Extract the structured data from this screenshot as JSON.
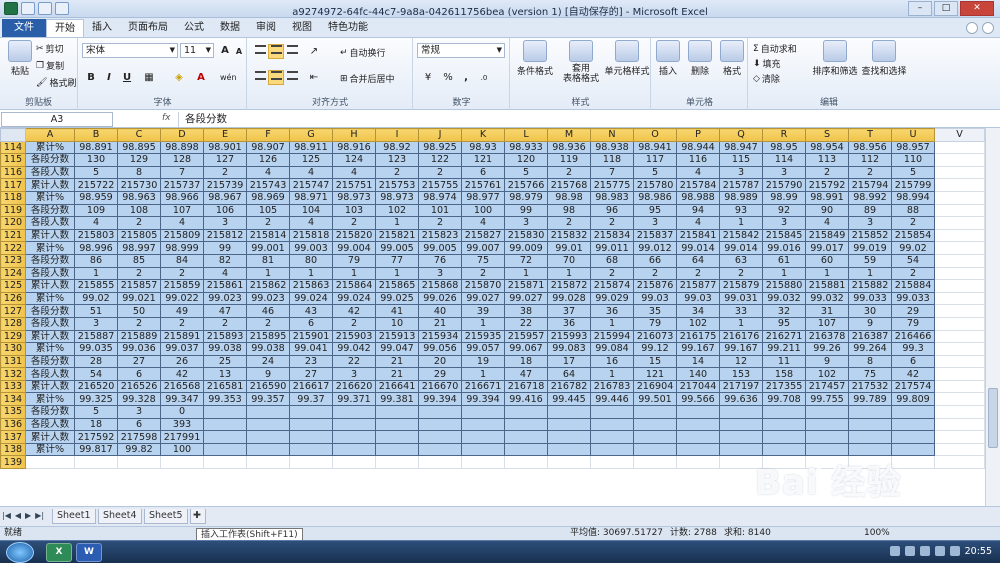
{
  "window": {
    "title": "a9274972-64fc-44c7-9a8a-042611756bea (version 1) [自动保存的] - Microsoft Excel",
    "min": "–",
    "max": "□",
    "close": "✕"
  },
  "tabs": [
    "文件",
    "开始",
    "插入",
    "页面布局",
    "公式",
    "数据",
    "审阅",
    "视图",
    "特色功能"
  ],
  "ribbon": {
    "clipboard": {
      "label": "剪贴板",
      "paste": "粘贴",
      "cut": "剪切",
      "copy": "复制",
      "format_painter": "格式刷"
    },
    "font": {
      "label": "字体",
      "name": "宋体",
      "size": "11",
      "bold": "B",
      "italic": "I",
      "underline": "U",
      "grow": "A",
      "shrink": "A",
      "wen": "wén"
    },
    "alignment": {
      "label": "对齐方式",
      "wrap": "自动换行",
      "merge": "合并后居中"
    },
    "number": {
      "label": "数字",
      "format": "常规",
      "percent": "%",
      "comma": ","
    },
    "styles": {
      "label": "样式",
      "conditional": "条件格式",
      "table": "套用\n表格格式",
      "cell": "单元格样式"
    },
    "cells": {
      "label": "单元格",
      "insert": "插入",
      "delete": "删除",
      "format": "格式"
    },
    "editing": {
      "label": "编辑",
      "autosum": "自动求和",
      "fill": "填充",
      "clear": "清除",
      "sort": "排序和筛选",
      "find": "查找和选择"
    }
  },
  "formula": {
    "cell": "A3",
    "fx": "fx",
    "value": "各段分数"
  },
  "columns": [
    "A",
    "B",
    "C",
    "D",
    "E",
    "F",
    "G",
    "H",
    "I",
    "J",
    "K",
    "L",
    "M",
    "N",
    "O",
    "P",
    "Q",
    "R",
    "S",
    "T",
    "U",
    "V"
  ],
  "rows": [
    {
      "n": "114",
      "cells": [
        "累计%",
        "98.891",
        "98.895",
        "98.898",
        "98.901",
        "98.907",
        "98.911",
        "98.916",
        "98.92",
        "98.925",
        "98.93",
        "98.933",
        "98.936",
        "98.938",
        "98.941",
        "98.944",
        "98.947",
        "98.95",
        "98.954",
        "98.956",
        "98.957"
      ]
    },
    {
      "n": "115",
      "cells": [
        "各段分数",
        "130",
        "129",
        "128",
        "127",
        "126",
        "125",
        "124",
        "123",
        "122",
        "121",
        "120",
        "119",
        "118",
        "117",
        "116",
        "115",
        "114",
        "113",
        "112",
        "110"
      ]
    },
    {
      "n": "116",
      "cells": [
        "各段人数",
        "5",
        "8",
        "7",
        "2",
        "4",
        "4",
        "4",
        "2",
        "2",
        "6",
        "5",
        "2",
        "7",
        "5",
        "4",
        "3",
        "3",
        "2",
        "2",
        "5"
      ]
    },
    {
      "n": "117",
      "cells": [
        "累计人数",
        "215722",
        "215730",
        "215737",
        "215739",
        "215743",
        "215747",
        "215751",
        "215753",
        "215755",
        "215761",
        "215766",
        "215768",
        "215775",
        "215780",
        "215784",
        "215787",
        "215790",
        "215792",
        "215794",
        "215799"
      ]
    },
    {
      "n": "118",
      "cells": [
        "累计%",
        "98.959",
        "98.963",
        "98.966",
        "98.967",
        "98.969",
        "98.971",
        "98.973",
        "98.973",
        "98.974",
        "98.977",
        "98.979",
        "98.98",
        "98.983",
        "98.986",
        "98.988",
        "98.989",
        "98.99",
        "98.991",
        "98.992",
        "98.994"
      ]
    },
    {
      "n": "119",
      "cells": [
        "各段分数",
        "109",
        "108",
        "107",
        "106",
        "105",
        "104",
        "103",
        "102",
        "101",
        "100",
        "99",
        "98",
        "96",
        "95",
        "94",
        "93",
        "92",
        "90",
        "89",
        "88"
      ]
    },
    {
      "n": "120",
      "cells": [
        "各段人数",
        "4",
        "2",
        "4",
        "3",
        "2",
        "4",
        "2",
        "1",
        "2",
        "4",
        "3",
        "2",
        "2",
        "3",
        "4",
        "1",
        "3",
        "4",
        "3",
        "2"
      ]
    },
    {
      "n": "121",
      "cells": [
        "累计人数",
        "215803",
        "215805",
        "215809",
        "215812",
        "215814",
        "215818",
        "215820",
        "215821",
        "215823",
        "215827",
        "215830",
        "215832",
        "215834",
        "215837",
        "215841",
        "215842",
        "215845",
        "215849",
        "215852",
        "215854"
      ]
    },
    {
      "n": "122",
      "cells": [
        "累计%",
        "98.996",
        "98.997",
        "98.999",
        "99",
        "99.001",
        "99.003",
        "99.004",
        "99.005",
        "99.005",
        "99.007",
        "99.009",
        "99.01",
        "99.011",
        "99.012",
        "99.014",
        "99.014",
        "99.016",
        "99.017",
        "99.019",
        "99.02"
      ]
    },
    {
      "n": "123",
      "cells": [
        "各段分数",
        "86",
        "85",
        "84",
        "82",
        "81",
        "80",
        "79",
        "77",
        "76",
        "75",
        "72",
        "70",
        "68",
        "66",
        "64",
        "63",
        "61",
        "60",
        "59",
        "54"
      ]
    },
    {
      "n": "124",
      "cells": [
        "各段人数",
        "1",
        "2",
        "2",
        "4",
        "1",
        "1",
        "1",
        "1",
        "3",
        "2",
        "1",
        "1",
        "2",
        "2",
        "2",
        "2",
        "1",
        "1",
        "1",
        "2"
      ]
    },
    {
      "n": "125",
      "cells": [
        "累计人数",
        "215855",
        "215857",
        "215859",
        "215861",
        "215862",
        "215863",
        "215864",
        "215865",
        "215868",
        "215870",
        "215871",
        "215872",
        "215874",
        "215876",
        "215877",
        "215879",
        "215880",
        "215881",
        "215882",
        "215884"
      ]
    },
    {
      "n": "126",
      "cells": [
        "累计%",
        "99.02",
        "99.021",
        "99.022",
        "99.023",
        "99.023",
        "99.024",
        "99.024",
        "99.025",
        "99.026",
        "99.027",
        "99.027",
        "99.028",
        "99.029",
        "99.03",
        "99.03",
        "99.031",
        "99.032",
        "99.032",
        "99.033",
        "99.033"
      ]
    },
    {
      "n": "127",
      "cells": [
        "各段分数",
        "51",
        "50",
        "49",
        "47",
        "46",
        "43",
        "42",
        "41",
        "40",
        "39",
        "38",
        "37",
        "36",
        "35",
        "34",
        "33",
        "32",
        "31",
        "30",
        "29"
      ]
    },
    {
      "n": "128",
      "cells": [
        "各段人数",
        "3",
        "2",
        "2",
        "2",
        "2",
        "6",
        "2",
        "10",
        "21",
        "1",
        "22",
        "36",
        "1",
        "79",
        "102",
        "1",
        "95",
        "107",
        "9",
        "79"
      ]
    },
    {
      "n": "129",
      "cells": [
        "累计人数",
        "215887",
        "215889",
        "215891",
        "215893",
        "215895",
        "215901",
        "215903",
        "215913",
        "215934",
        "215935",
        "215957",
        "215993",
        "215994",
        "216073",
        "216175",
        "216176",
        "216271",
        "216378",
        "216387",
        "216466"
      ]
    },
    {
      "n": "130",
      "cells": [
        "累计%",
        "99.035",
        "99.036",
        "99.037",
        "99.038",
        "99.038",
        "99.041",
        "99.042",
        "99.047",
        "99.056",
        "99.057",
        "99.067",
        "99.083",
        "99.084",
        "99.12",
        "99.167",
        "99.167",
        "99.211",
        "99.26",
        "99.264",
        "99.3"
      ]
    },
    {
      "n": "131",
      "cells": [
        "各段分数",
        "28",
        "27",
        "26",
        "25",
        "24",
        "23",
        "22",
        "21",
        "20",
        "19",
        "18",
        "17",
        "16",
        "15",
        "14",
        "12",
        "11",
        "9",
        "8",
        "6"
      ]
    },
    {
      "n": "132",
      "cells": [
        "各段人数",
        "54",
        "6",
        "42",
        "13",
        "9",
        "27",
        "3",
        "21",
        "29",
        "1",
        "47",
        "64",
        "1",
        "121",
        "140",
        "153",
        "158",
        "102",
        "75",
        "42"
      ]
    },
    {
      "n": "133",
      "cells": [
        "累计人数",
        "216520",
        "216526",
        "216568",
        "216581",
        "216590",
        "216617",
        "216620",
        "216641",
        "216670",
        "216671",
        "216718",
        "216782",
        "216783",
        "216904",
        "217044",
        "217197",
        "217355",
        "217457",
        "217532",
        "217574"
      ]
    },
    {
      "n": "134",
      "cells": [
        "累计%",
        "99.325",
        "99.328",
        "99.347",
        "99.353",
        "99.357",
        "99.37",
        "99.371",
        "99.381",
        "99.394",
        "99.394",
        "99.416",
        "99.445",
        "99.446",
        "99.501",
        "99.566",
        "99.636",
        "99.708",
        "99.755",
        "99.789",
        "99.809"
      ]
    },
    {
      "n": "135",
      "cells": [
        "各段分数",
        "5",
        "3",
        "0"
      ]
    },
    {
      "n": "136",
      "cells": [
        "各段人数",
        "18",
        "6",
        "393"
      ]
    },
    {
      "n": "137",
      "cells": [
        "累计人数",
        "217592",
        "217598",
        "217991"
      ]
    },
    {
      "n": "138",
      "cells": [
        "累计%",
        "99.817",
        "99.82",
        "100"
      ]
    },
    {
      "n": "139",
      "cells": []
    }
  ],
  "sheets": [
    "Sheet1",
    "Sheet4",
    "Sheet5"
  ],
  "status": {
    "ready": "就绪",
    "average": "平均值: 30697.51727",
    "count": "计数: 2788",
    "sum": "求和: 8140",
    "zoom": "100%",
    "tooltip": "插入工作表(Shift+F11)"
  },
  "taskbar": {
    "time": "20:55",
    "word": "W"
  },
  "watermark": {
    "text": "Bai 经验",
    "url": "jingyan.baidu.com"
  },
  "colors": {
    "header_selected": "#f0c34a",
    "cell_fill": "#b8d3ef",
    "file_tab": "#2a5ea8"
  }
}
